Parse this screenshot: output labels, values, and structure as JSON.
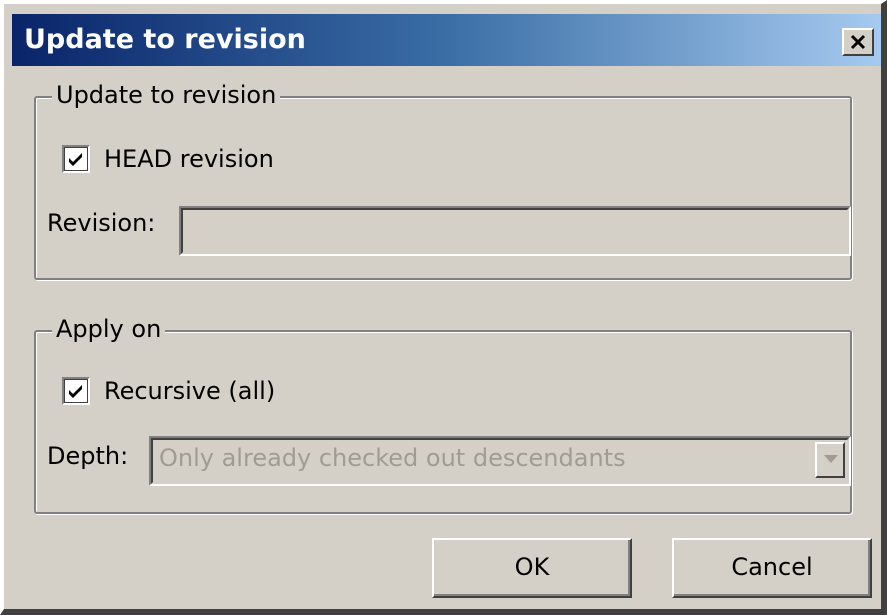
{
  "window": {
    "title": "Update to revision"
  },
  "revision_group": {
    "legend": "Update to revision",
    "head_checkbox": {
      "label": "HEAD revision",
      "checked": true
    },
    "revision_label": "Revision:",
    "revision_value": ""
  },
  "apply_group": {
    "legend": "Apply on",
    "recursive_checkbox": {
      "label": "Recursive (all)",
      "checked": true
    },
    "depth_label": "Depth:",
    "depth_selected": "Only already checked out descendants"
  },
  "buttons": {
    "ok": "OK",
    "cancel": "Cancel"
  },
  "colors": {
    "title_gradient_start": "#0a246a",
    "title_gradient_end": "#a6caf0",
    "face": "#d4d0c8",
    "disabled_text": "#a09c94"
  }
}
